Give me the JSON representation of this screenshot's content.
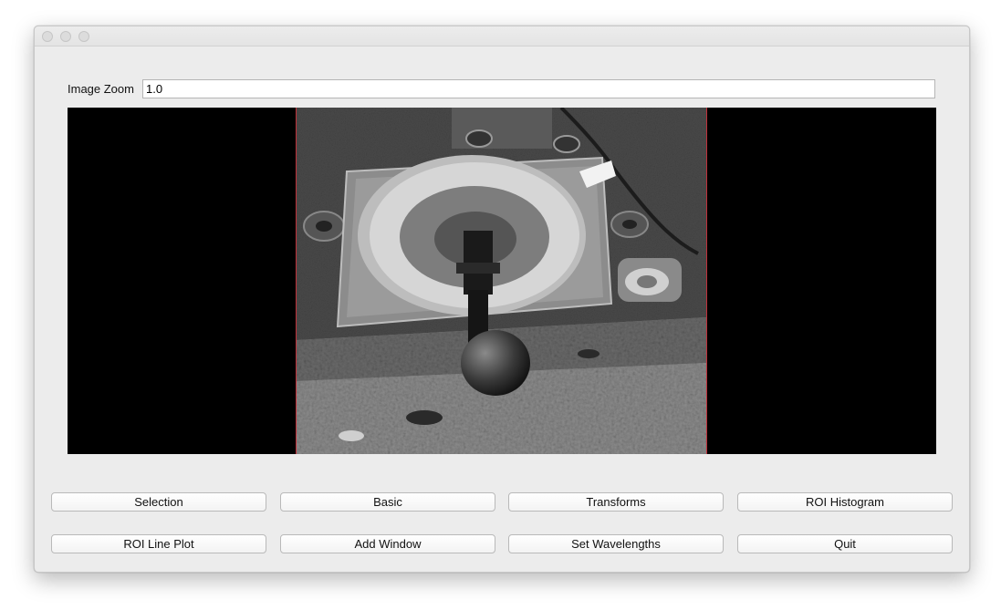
{
  "window": {
    "title": ""
  },
  "zoom": {
    "label": "Image Zoom",
    "value": "1.0"
  },
  "image": {
    "description_icon": "image-view-icon"
  },
  "buttons": {
    "row1": [
      "Selection",
      "Basic",
      "Transforms",
      "ROI Histogram"
    ],
    "row2": [
      "ROI Line Plot",
      "Add Window",
      "Set Wavelengths",
      "Quit"
    ]
  },
  "colors": {
    "window_bg": "#ececec",
    "canvas_bg": "#000000",
    "image_border": "#c0303a"
  }
}
